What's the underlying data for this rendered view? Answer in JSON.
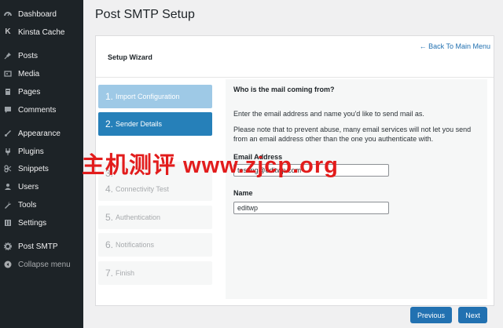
{
  "sidebar": {
    "items": [
      {
        "label": "Dashboard",
        "icon": "dashboard-icon"
      },
      {
        "label": "Kinsta Cache",
        "icon": "kinsta-icon"
      },
      {
        "label": "Posts",
        "icon": "pin-icon"
      },
      {
        "label": "Media",
        "icon": "media-icon"
      },
      {
        "label": "Pages",
        "icon": "pages-icon"
      },
      {
        "label": "Comments",
        "icon": "comments-icon"
      },
      {
        "label": "Appearance",
        "icon": "appearance-icon"
      },
      {
        "label": "Plugins",
        "icon": "plugins-icon"
      },
      {
        "label": "Snippets",
        "icon": "snippets-icon"
      },
      {
        "label": "Users",
        "icon": "users-icon"
      },
      {
        "label": "Tools",
        "icon": "tools-icon"
      },
      {
        "label": "Settings",
        "icon": "settings-icon"
      },
      {
        "label": "Post SMTP",
        "icon": "gear-icon"
      },
      {
        "label": "Collapse menu",
        "icon": "collapse-icon"
      }
    ]
  },
  "page": {
    "title": "Post SMTP Setup",
    "wizard_label": "Setup Wizard",
    "back_link": "Back To Main Menu"
  },
  "steps": [
    {
      "num": "1.",
      "label": "Import Configuration",
      "state": "done"
    },
    {
      "num": "2.",
      "label": "Sender Details",
      "state": "active"
    },
    {
      "num": "3.",
      "label": "",
      "state": "pending"
    },
    {
      "num": "4.",
      "label": "Connectivity Test",
      "state": "pending"
    },
    {
      "num": "5.",
      "label": "Authentication",
      "state": "pending"
    },
    {
      "num": "6.",
      "label": "Notifications",
      "state": "pending"
    },
    {
      "num": "7.",
      "label": "Finish",
      "state": "pending"
    }
  ],
  "content": {
    "heading": "Who is the mail coming from?",
    "intro": "Enter the email address and name you'd like to send mail as.",
    "note": "Please note that to prevent abuse, many email services will not let you send from an email address other than the one you authenticate with.",
    "email_label": "Email Address",
    "email_value": "testing@editwp.com",
    "name_label": "Name",
    "name_value": "editwp"
  },
  "buttons": {
    "previous": "Previous",
    "next": "Next"
  },
  "watermark": "主机测评 www.zjcp.org",
  "colors": {
    "sidebar_bg": "#1d2327",
    "active_step": "#2680b9",
    "done_step": "#9ec9e6",
    "button": "#2271b1",
    "watermark": "#e21c1c"
  }
}
